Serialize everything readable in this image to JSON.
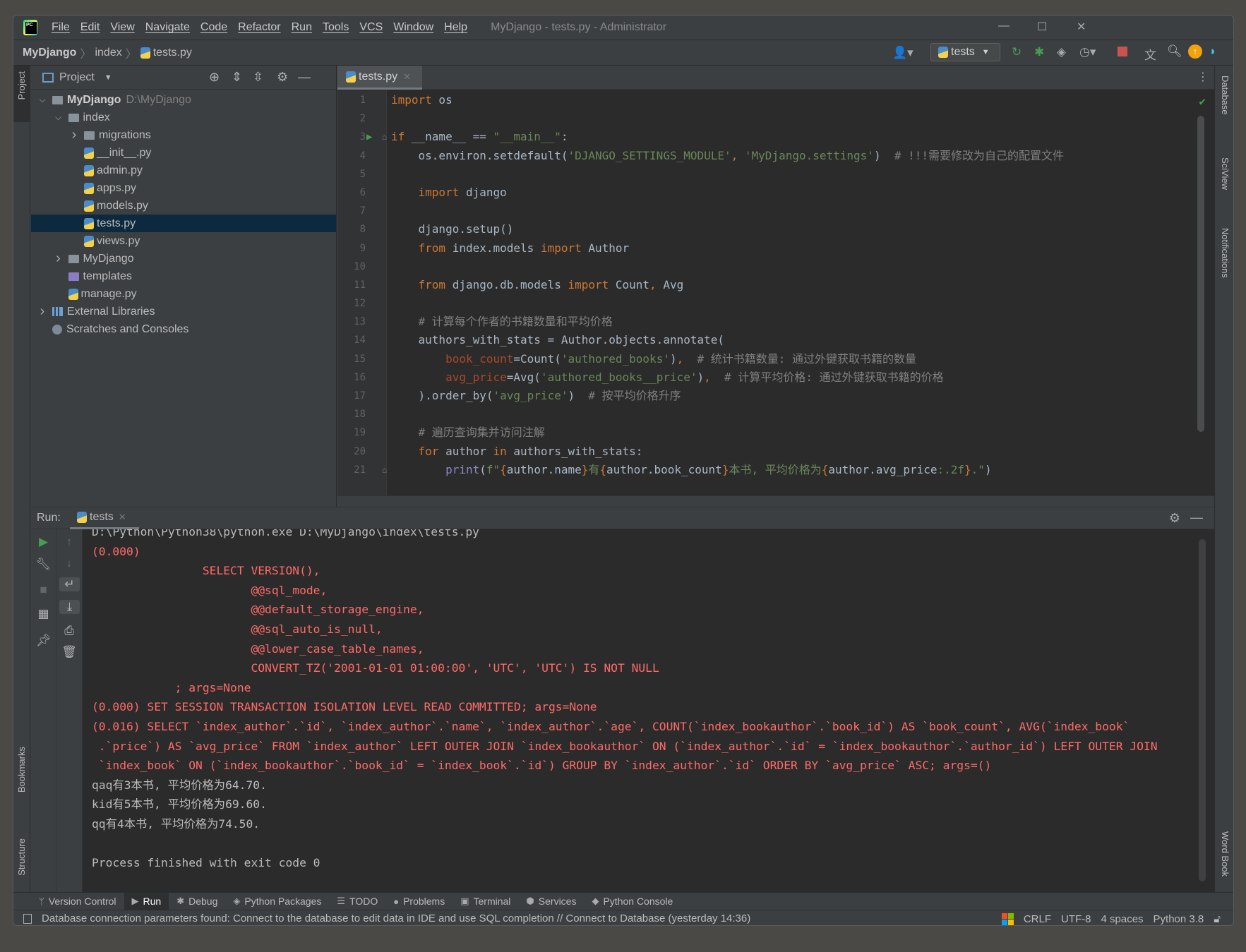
{
  "window": {
    "title": "MyDjango - tests.py - Administrator",
    "menu": [
      "File",
      "Edit",
      "View",
      "Navigate",
      "Code",
      "Refactor",
      "Run",
      "Tools",
      "VCS",
      "Window",
      "Help"
    ]
  },
  "navbar": {
    "breadcrumbs": [
      "MyDjango",
      "index",
      "tests.py"
    ],
    "run_config": "tests"
  },
  "left_stripe": {
    "project": "Project",
    "bookmarks": "Bookmarks",
    "structure": "Structure"
  },
  "right_stripe": {
    "database": "Database",
    "sciview": "SciView",
    "notifications": "Notifications",
    "word_book": "Word Book"
  },
  "project": {
    "title": "Project",
    "tree": [
      {
        "label": "MyDjango",
        "hint": "D:\\MyDjango",
        "level": 0,
        "arrow": "down",
        "icon": "folder",
        "bold": true
      },
      {
        "label": "index",
        "level": 1,
        "arrow": "down",
        "icon": "folder"
      },
      {
        "label": "migrations",
        "level": 2,
        "arrow": "right",
        "icon": "folder"
      },
      {
        "label": "__init__.py",
        "level": 2,
        "icon": "python"
      },
      {
        "label": "admin.py",
        "level": 2,
        "icon": "python"
      },
      {
        "label": "apps.py",
        "level": 2,
        "icon": "python"
      },
      {
        "label": "models.py",
        "level": 2,
        "icon": "python"
      },
      {
        "label": "tests.py",
        "level": 2,
        "icon": "python",
        "selected": true
      },
      {
        "label": "views.py",
        "level": 2,
        "icon": "python"
      },
      {
        "label": "MyDjango",
        "level": 1,
        "arrow": "right",
        "icon": "folder"
      },
      {
        "label": "templates",
        "level": 1,
        "icon": "folder-purple"
      },
      {
        "label": "manage.py",
        "level": 1,
        "icon": "python"
      },
      {
        "label": "External Libraries",
        "level": 0,
        "arrow": "right",
        "icon": "library"
      },
      {
        "label": "Scratches and Consoles",
        "level": 0,
        "icon": "scratch"
      }
    ]
  },
  "editor": {
    "tab": "tests.py",
    "lines": [
      [
        [
          "import",
          "k"
        ],
        [
          " os",
          "d"
        ]
      ],
      [],
      [
        [
          "if",
          "k"
        ],
        [
          " __name__ == ",
          "d"
        ],
        [
          "\"__main__\"",
          "s"
        ],
        [
          ":",
          "d"
        ]
      ],
      [
        [
          "    os.environ.setdefault(",
          "d"
        ],
        [
          "'DJANGO_SETTINGS_MODULE'",
          "s"
        ],
        [
          ", ",
          "k"
        ],
        [
          "'MyDjango.settings'",
          "s"
        ],
        [
          ")  ",
          "d"
        ],
        [
          "# !!!需要修改为自己的配置文件",
          "c"
        ]
      ],
      [],
      [
        [
          "    ",
          "d"
        ],
        [
          "import",
          "k"
        ],
        [
          " django",
          "d"
        ]
      ],
      [],
      [
        [
          "    django.setup()",
          "d"
        ]
      ],
      [
        [
          "    ",
          "d"
        ],
        [
          "from",
          "k"
        ],
        [
          " index.models ",
          "d"
        ],
        [
          "import",
          "k"
        ],
        [
          " Author",
          "d"
        ]
      ],
      [],
      [
        [
          "    ",
          "d"
        ],
        [
          "from",
          "k"
        ],
        [
          " django.db.models ",
          "d"
        ],
        [
          "import",
          "k"
        ],
        [
          " Count",
          "d"
        ],
        [
          ",",
          "k"
        ],
        [
          " Avg",
          "d"
        ]
      ],
      [],
      [
        [
          "    # 计算每个作者的书籍数量和平均价格",
          "c"
        ]
      ],
      [
        [
          "    authors_with_stats = Author.objects.annotate(",
          "d"
        ]
      ],
      [
        [
          "        ",
          "d"
        ],
        [
          "book_count",
          "p"
        ],
        [
          "=Count(",
          "d"
        ],
        [
          "'authored_books'",
          "s"
        ],
        [
          ")",
          "d"
        ],
        [
          ",",
          "k"
        ],
        [
          "  # 统计书籍数量: 通过外键获取书籍的数量",
          "c"
        ]
      ],
      [
        [
          "        ",
          "d"
        ],
        [
          "avg_price",
          "p"
        ],
        [
          "=Avg(",
          "d"
        ],
        [
          "'authored_books__price'",
          "s"
        ],
        [
          ")",
          "d"
        ],
        [
          ",",
          "k"
        ],
        [
          "  # 计算平均价格: 通过外键获取书籍的价格",
          "c"
        ]
      ],
      [
        [
          "    ).order_by(",
          "d"
        ],
        [
          "'avg_price'",
          "s"
        ],
        [
          ")  ",
          "d"
        ],
        [
          "# 按平均价格升序",
          "c"
        ]
      ],
      [],
      [
        [
          "    # 遍历查询集并访问注解",
          "c"
        ]
      ],
      [
        [
          "    ",
          "d"
        ],
        [
          "for",
          "k"
        ],
        [
          " author ",
          "d"
        ],
        [
          "in",
          "k"
        ],
        [
          " authors_with_stats:",
          "d"
        ]
      ],
      [
        [
          "        ",
          "d"
        ],
        [
          "print",
          "b"
        ],
        [
          "(",
          "d"
        ],
        [
          "f\"",
          "s"
        ],
        [
          "{",
          "k"
        ],
        [
          "author.name",
          "d"
        ],
        [
          "}",
          "k"
        ],
        [
          "有",
          "s"
        ],
        [
          "{",
          "k"
        ],
        [
          "author.book_count",
          "d"
        ],
        [
          "}",
          "k"
        ],
        [
          "本书, 平均价格为",
          "s"
        ],
        [
          "{",
          "k"
        ],
        [
          "author.avg_price",
          "d"
        ],
        [
          ":.2f",
          "s"
        ],
        [
          "}",
          "k"
        ],
        [
          ".\"",
          "s"
        ],
        [
          ")",
          "d"
        ]
      ]
    ]
  },
  "run": {
    "label": "Run:",
    "tab": "tests",
    "output": [
      {
        "text": "D:\\Python\\Python38\\python.exe D:\\MyDjango\\index\\tests.py",
        "kind": "norm"
      },
      {
        "text": "(0.000)",
        "kind": "err"
      },
      {
        "text": "                SELECT VERSION(),",
        "kind": "err"
      },
      {
        "text": "                       @@sql_mode,",
        "kind": "err"
      },
      {
        "text": "                       @@default_storage_engine,",
        "kind": "err"
      },
      {
        "text": "                       @@sql_auto_is_null,",
        "kind": "err"
      },
      {
        "text": "                       @@lower_case_table_names,",
        "kind": "err"
      },
      {
        "text": "                       CONVERT_TZ('2001-01-01 01:00:00', 'UTC', 'UTC') IS NOT NULL",
        "kind": "err"
      },
      {
        "text": "            ; args=None",
        "kind": "err"
      },
      {
        "text": "(0.000) SET SESSION TRANSACTION ISOLATION LEVEL READ COMMITTED; args=None",
        "kind": "err"
      },
      {
        "text": "(0.016) SELECT `index_author`.`id`, `index_author`.`name`, `index_author`.`age`, COUNT(`index_bookauthor`.`book_id`) AS `book_count`, AVG(`index_book`",
        "kind": "err"
      },
      {
        "text": " .`price`) AS `avg_price` FROM `index_author` LEFT OUTER JOIN `index_bookauthor` ON (`index_author`.`id` = `index_bookauthor`.`author_id`) LEFT OUTER JOIN",
        "kind": "err"
      },
      {
        "text": " `index_book` ON (`index_bookauthor`.`book_id` = `index_book`.`id`) GROUP BY `index_author`.`id` ORDER BY `avg_price` ASC; args=()",
        "kind": "err"
      },
      {
        "text": "qaq有3本书, 平均价格为64.70.",
        "kind": "norm"
      },
      {
        "text": "kid有5本书, 平均价格为69.60.",
        "kind": "norm"
      },
      {
        "text": "qq有4本书, 平均价格为74.50.",
        "kind": "norm"
      },
      {
        "text": "",
        "kind": "norm"
      },
      {
        "text": "Process finished with exit code 0",
        "kind": "norm"
      }
    ]
  },
  "bottom_tabs": [
    {
      "label": "Version Control",
      "icon": "branch-icon"
    },
    {
      "label": "Run",
      "icon": "play-icon",
      "active": true
    },
    {
      "label": "Debug",
      "icon": "bug-icon"
    },
    {
      "label": "Python Packages",
      "icon": "layers-icon"
    },
    {
      "label": "TODO",
      "icon": "list-icon"
    },
    {
      "label": "Problems",
      "icon": "info-icon"
    },
    {
      "label": "Terminal",
      "icon": "terminal-icon"
    },
    {
      "label": "Services",
      "icon": "services-icon"
    },
    {
      "label": "Python Console",
      "icon": "python-icon"
    }
  ],
  "status": {
    "message": "Database connection parameters found: Connect to the database to edit data in IDE and use SQL completion // Connect to Database (yesterday 14:36)",
    "line_sep": "CRLF",
    "encoding": "UTF-8",
    "indent": "4 spaces",
    "interpreter": "Python 3.8"
  },
  "colors": {
    "keyword": "#cc7832",
    "string": "#6a8759",
    "comment": "#808080",
    "error_output": "#ff6b68",
    "selection": "#0d293e"
  }
}
